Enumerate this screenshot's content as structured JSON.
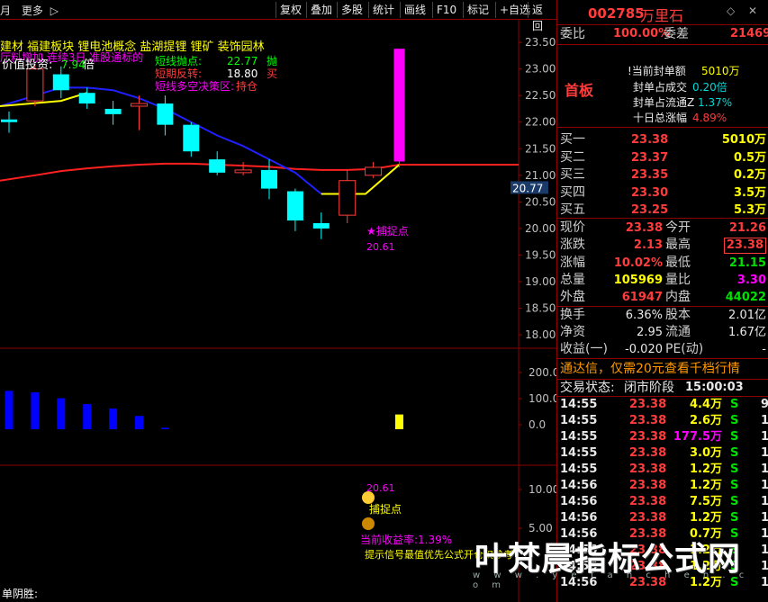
{
  "toolbar": {
    "left_label": "月",
    "more": "更多",
    "more_arrow": "▷",
    "buttons": [
      "复权",
      "叠加",
      "多股",
      "统计",
      "画线",
      "F10",
      "标记",
      "+自选",
      "返回"
    ]
  },
  "stock": {
    "code": "002785",
    "name": "万里石",
    "diamond": "◇",
    "close": "✕"
  },
  "order_ratio": {
    "label1": "委比",
    "value1": "100.00%",
    "label2": "委差",
    "value2": "21469"
  },
  "seal_info": {
    "tag": "首板",
    "rows": [
      {
        "label": "!当前封单额",
        "value": "5010万"
      },
      {
        "label": "封单占成交",
        "value": "0.20倍"
      },
      {
        "label": "封单占流通Z",
        "value": "1.37%"
      },
      {
        "label": "十日总涨幅",
        "value": "4.89%"
      }
    ]
  },
  "buy_levels": [
    {
      "label": "买一",
      "price": "23.38",
      "volume": "5010万"
    },
    {
      "label": "买二",
      "price": "23.37",
      "volume": "0.5万"
    },
    {
      "label": "买三",
      "price": "23.35",
      "volume": "0.2万"
    },
    {
      "label": "买四",
      "price": "23.30",
      "volume": "3.5万"
    },
    {
      "label": "买五",
      "price": "23.25",
      "volume": "5.3万"
    }
  ],
  "quote": [
    {
      "l1": "现价",
      "v1": "23.38",
      "l2": "今开",
      "v2": "21.26"
    },
    {
      "l1": "涨跌",
      "v1": "2.13",
      "l2": "最高",
      "v2": "23.38"
    },
    {
      "l1": "涨幅",
      "v1": "10.02%",
      "l2": "最低",
      "v2": "21.15"
    },
    {
      "l1": "总量",
      "v1": "105969",
      "l2": "量比",
      "v2": "3.30"
    },
    {
      "l1": "外盘",
      "v1": "61947",
      "l2": "内盘",
      "v2": "44022"
    }
  ],
  "fundamentals": [
    {
      "l1": "换手",
      "v1": "6.36%",
      "l2": "股本",
      "v2": "2.01亿"
    },
    {
      "l1": "净资",
      "v1": "2.95",
      "l2": "流通",
      "v2": "1.67亿"
    },
    {
      "l1": "收益(一)",
      "v1": "-0.020",
      "l2": "PE(动)",
      "v2": "-"
    }
  ],
  "promo": "通达信，仅需20元查看千档行情",
  "trade_status": {
    "label": "交易状态:",
    "value": "闭市阶段",
    "time": "15:00:03"
  },
  "trades": [
    {
      "time": "14:55",
      "price": "23.38",
      "vol": "4.4万",
      "side": "S",
      "n": "9"
    },
    {
      "time": "14:55",
      "price": "23.38",
      "vol": "2.6万",
      "side": "S",
      "n": "1"
    },
    {
      "time": "14:55",
      "price": "23.38",
      "vol": "177.5万",
      "side": "S",
      "n": "1"
    },
    {
      "time": "14:55",
      "price": "23.38",
      "vol": "3.0万",
      "side": "S",
      "n": "1"
    },
    {
      "time": "14:55",
      "price": "23.38",
      "vol": "1.2万",
      "side": "S",
      "n": "1"
    },
    {
      "time": "14:56",
      "price": "23.38",
      "vol": "1.2万",
      "side": "S",
      "n": "1"
    },
    {
      "time": "14:56",
      "price": "23.38",
      "vol": "7.5万",
      "side": "S",
      "n": "1"
    },
    {
      "time": "14:56",
      "price": "23.38",
      "vol": "1.2万",
      "side": "S",
      "n": "1"
    },
    {
      "time": "14:56",
      "price": "23.38",
      "vol": "0.7万",
      "side": "S",
      "n": "1"
    },
    {
      "time": "14:56",
      "price": "23.38",
      "vol": "1.2万",
      "side": "S",
      "n": "1"
    },
    {
      "time": "14:56",
      "price": "23.38",
      "vol": "1.2万",
      "side": "S",
      "n": "1"
    },
    {
      "time": "14:56",
      "price": "23.38",
      "vol": "1.2万",
      "side": "S",
      "n": "1"
    }
  ],
  "main_chart": {
    "concepts_line1": "建材   福建板块  锂电池概念  盐湖提锂  锂矿  装饰园林",
    "concepts_line2": "厅料增加  连续3日  准股通标的",
    "value_label": "价值投资:",
    "value_pct": "7.94",
    "value_suffix": "倍",
    "signals": [
      {
        "label": "短线抛点:",
        "value": "22.77",
        "action": "抛"
      },
      {
        "label": "短期反转:",
        "value": "18.80",
        "action": "买"
      },
      {
        "label": "短线多空决策区:",
        "value": "",
        "action": "持仓"
      }
    ],
    "capture_label": "★捕捉点",
    "capture_value": "20.61",
    "price_tag": "20.77",
    "y_ticks": [
      "23.50",
      "23.00",
      "22.50",
      "22.00",
      "21.50",
      "21.00",
      "20.50",
      "20.00",
      "19.50",
      "19.00",
      "18.50",
      "18.00"
    ]
  },
  "chart_data": [
    {
      "type": "candlestick",
      "ylim": [
        17.9,
        23.62
      ],
      "y_ticks": [
        23.5,
        23.0,
        22.5,
        22.0,
        21.5,
        21.0,
        20.5,
        20.0,
        19.5,
        19.0,
        18.5,
        18.0
      ],
      "candles": [
        {
          "o": 22.0,
          "h": 22.2,
          "c": 22.05,
          "l": 21.8,
          "dir": "down"
        },
        {
          "o": 22.4,
          "h": 23.1,
          "c": 23.0,
          "l": 22.3,
          "dir": "up"
        },
        {
          "o": 22.9,
          "h": 23.05,
          "c": 22.6,
          "l": 22.45,
          "dir": "down"
        },
        {
          "o": 22.55,
          "h": 22.65,
          "c": 22.35,
          "l": 22.25,
          "dir": "down"
        },
        {
          "o": 22.25,
          "h": 22.4,
          "c": 22.15,
          "l": 21.95,
          "dir": "down"
        },
        {
          "o": 22.3,
          "h": 22.5,
          "c": 22.35,
          "l": 21.85,
          "dir": "up"
        },
        {
          "o": 22.35,
          "h": 22.5,
          "c": 21.95,
          "l": 21.75,
          "dir": "down"
        },
        {
          "o": 21.95,
          "h": 22.0,
          "c": 21.45,
          "l": 21.35,
          "dir": "down"
        },
        {
          "o": 21.3,
          "h": 21.45,
          "c": 21.05,
          "l": 21.0,
          "dir": "down"
        },
        {
          "o": 21.05,
          "h": 21.25,
          "c": 21.1,
          "l": 21.0,
          "dir": "up"
        },
        {
          "o": 21.1,
          "h": 21.3,
          "c": 20.75,
          "l": 20.55,
          "dir": "down"
        },
        {
          "o": 20.7,
          "h": 20.75,
          "c": 20.15,
          "l": 19.95,
          "dir": "down"
        },
        {
          "o": 20.1,
          "h": 20.3,
          "c": 20.0,
          "l": 19.8,
          "dir": "down"
        },
        {
          "o": 20.25,
          "h": 21.1,
          "c": 20.9,
          "l": 20.1,
          "dir": "up"
        },
        {
          "o": 21.0,
          "h": 21.25,
          "c": 21.15,
          "l": 20.95,
          "dir": "up"
        },
        {
          "o": 21.26,
          "h": 23.38,
          "c": 23.38,
          "l": 21.15,
          "dir": "limit"
        }
      ],
      "ma_blue": [
        22.3,
        22.5,
        22.65,
        22.65,
        22.6,
        22.45,
        22.25,
        22.0,
        21.75,
        21.55,
        21.3,
        21.05,
        20.65,
        20.65,
        20.65,
        20.95
      ],
      "ma_red": [
        20.9,
        21.0,
        21.08,
        21.13,
        21.17,
        21.2,
        21.22,
        21.22,
        21.2,
        21.18,
        21.16,
        21.12,
        21.1,
        21.1,
        21.12,
        21.2
      ],
      "ma_yellow": [
        22.3,
        22.4,
        22.55
      ]
    },
    {
      "type": "bar",
      "ylim": [
        0,
        250
      ],
      "y_ticks": [
        200.0,
        100.0,
        0.0
      ],
      "values": [
        130,
        125,
        105,
        85,
        70,
        45,
        5,
        0,
        0,
        0,
        0,
        0,
        0,
        0,
        0,
        50
      ],
      "colors": [
        "blue",
        "blue",
        "blue",
        "blue",
        "blue",
        "blue",
        "blue",
        "",
        "",
        "",
        "",
        "",
        "",
        "",
        "",
        "yellow"
      ]
    },
    {
      "type": "indicator",
      "ylim": [
        0,
        12
      ],
      "y_ticks": [
        10.0,
        5.0
      ],
      "capture_value": "20.61",
      "capture_label": "捕捉点",
      "profit_label": "当前收益率:1.39%",
      "hint_label": "提示信号最值优先公式开仓仅参考",
      "footer_label": "单阴胜:"
    }
  ],
  "watermark": {
    "title": "叶梵晨指标公式网",
    "url": "w w w . y e f a n c h e n . c o m"
  }
}
